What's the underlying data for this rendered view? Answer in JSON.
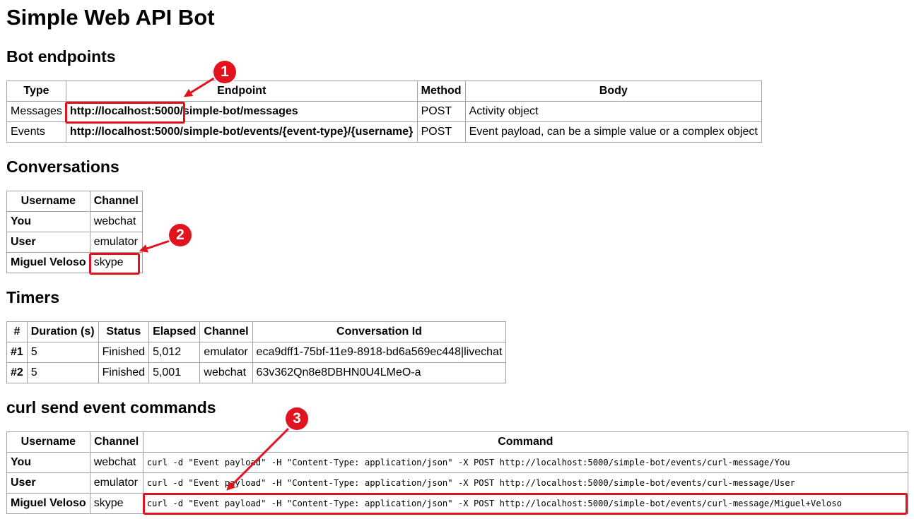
{
  "title": "Simple Web API Bot",
  "sections": {
    "endpoints": "Bot endpoints",
    "conversations": "Conversations",
    "timers": "Timers",
    "curl": "curl send event commands"
  },
  "endpoints_table": {
    "headers": [
      "Type",
      "Endpoint",
      "Method",
      "Body"
    ],
    "rows": [
      {
        "type": "Messages",
        "endpoint": "http://localhost:5000/simple-bot/messages",
        "method": "POST",
        "body": "Activity object"
      },
      {
        "type": "Events",
        "endpoint": "http://localhost:5000/simple-bot/events/{event-type}/{username}",
        "method": "POST",
        "body": "Event payload, can be a simple value or a complex object"
      }
    ]
  },
  "conversations_table": {
    "headers": [
      "Username",
      "Channel"
    ],
    "rows": [
      {
        "username": "You",
        "channel": "webchat"
      },
      {
        "username": "User",
        "channel": "emulator"
      },
      {
        "username": "Miguel Veloso",
        "channel": "skype"
      }
    ]
  },
  "timers_table": {
    "headers": [
      "#",
      "Duration (s)",
      "Status",
      "Elapsed",
      "Channel",
      "Conversation Id"
    ],
    "rows": [
      {
        "num": "#1",
        "duration": "5",
        "status": "Finished",
        "elapsed": "5,012",
        "channel": "emulator",
        "conversation_id": "eca9dff1-75bf-11e9-8918-bd6a569ec448|livechat"
      },
      {
        "num": "#2",
        "duration": "5",
        "status": "Finished",
        "elapsed": "5,001",
        "channel": "webchat",
        "conversation_id": "63v362Qn8e8DBHN0U4LMeO-a"
      }
    ]
  },
  "curl_table": {
    "headers": [
      "Username",
      "Channel",
      "Command"
    ],
    "rows": [
      {
        "username": "You",
        "channel": "webchat",
        "command": "curl -d \"Event payload\" -H \"Content-Type: application/json\" -X POST http://localhost:5000/simple-bot/events/curl-message/You"
      },
      {
        "username": "User",
        "channel": "emulator",
        "command": "curl -d \"Event payload\" -H \"Content-Type: application/json\" -X POST http://localhost:5000/simple-bot/events/curl-message/User"
      },
      {
        "username": "Miguel Veloso",
        "channel": "skype",
        "command": "curl -d \"Event payload\" -H \"Content-Type: application/json\" -X POST http://localhost:5000/simple-bot/events/curl-message/Miguel+Veloso"
      }
    ]
  },
  "annotations": {
    "badge1": "1",
    "badge2": "2",
    "badge3": "3",
    "accent_color": "#e0131e"
  }
}
